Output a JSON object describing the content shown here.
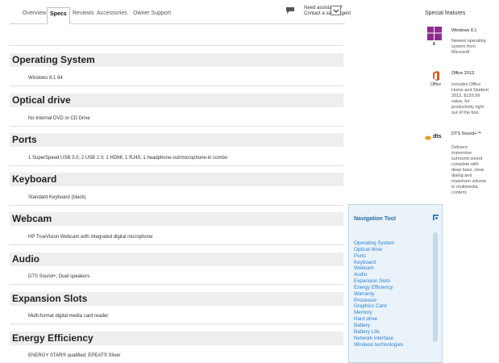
{
  "tabs": [
    {
      "label": "Overview",
      "active": false
    },
    {
      "label": "Specs",
      "active": true
    },
    {
      "label": "Reviews",
      "active": false
    },
    {
      "label": "Accessories",
      "active": false
    },
    {
      "label": "Owner Support",
      "active": false
    }
  ],
  "assistance": {
    "line1": "Need assistance?",
    "line2": "Contact a sales agent"
  },
  "sections": [
    {
      "title": "Operating System",
      "value": "Windows 8.1 64"
    },
    {
      "title": "Optical drive",
      "value": "No Internal DVD or CD Drive"
    },
    {
      "title": "Ports",
      "value": "1 SuperSpeed USB 3.0; 2 USB 2.0; 1 HDMI; 1 RJ45; 1 headphone-out/microphone-in combo"
    },
    {
      "title": "Keyboard",
      "value": "Standard Keyboard (black)"
    },
    {
      "title": "Webcam",
      "value": "HP TrueVision Webcam with integrated digital microphone"
    },
    {
      "title": "Audio",
      "value": "DTS Sound+; Dual speakers"
    },
    {
      "title": "Expansion Slots",
      "value": "Multi-format digital media card reader"
    },
    {
      "title": "Energy Efficiency",
      "value": "ENERGY STAR® qualified; EPEAT® Silver"
    }
  ],
  "special_features": {
    "title": "Special features",
    "items": [
      {
        "icon": "windows-8-logo-icon",
        "badge": "8",
        "name": "Windows 8.1",
        "description": "Newest operating\nsystem from\nMicrosoft"
      },
      {
        "icon": "office-logo-icon",
        "badge": "Office",
        "name": "Office 2013",
        "description": "Includes Office\nHome and Student\n2013, $139.99\nvalue, for\nproductivity right\nout of the box."
      },
      {
        "icon": "dts-logo-icon",
        "badge": "dts",
        "name": "DTS Sound+™",
        "description": "Delivers\nimmersive\nsurround sound\ncomplete with\ndeep bass, clear\ndialog and\nmaximum volume\nto multimedia\ncontent."
      }
    ]
  },
  "nav_tool": {
    "title": "Navigation Tool",
    "items": [
      "Operating System",
      "Optical drive",
      "Ports",
      "Keyboard",
      "Webcam",
      "Audio",
      "Expansion Slots",
      "Energy Efficiency",
      "Warranty",
      "Processor",
      "Graphics Card",
      "Memory",
      "Hard drive",
      "Battery",
      "Battery Life",
      "Network interface",
      "Wireless technologies"
    ]
  },
  "colors": {
    "section_header_bg": "#eeeeee",
    "nav_link": "#2a7fd4",
    "nav_bg": "#eaf3fa",
    "windows_tile": "#8e2c8e",
    "office_orange": "#e2571e",
    "dts_orange": "#f09a22"
  }
}
